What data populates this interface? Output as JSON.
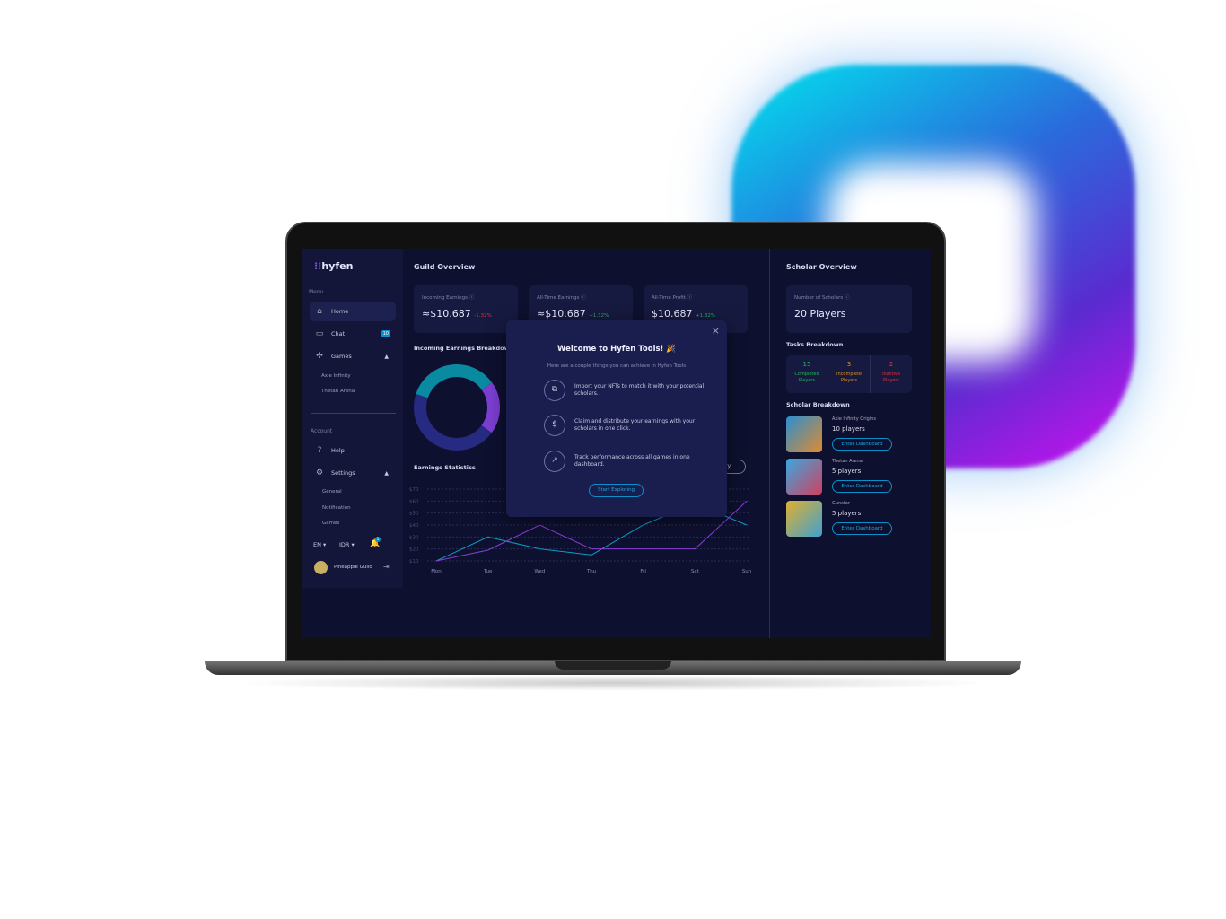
{
  "brand": {
    "name": "hyfen"
  },
  "sidebar": {
    "menu_label": "Menu",
    "items": [
      {
        "label": "Home",
        "icon": "home-icon"
      },
      {
        "label": "Chat",
        "icon": "chat-icon",
        "badge": "10"
      },
      {
        "label": "Games",
        "icon": "gamepad-icon"
      }
    ],
    "games": [
      "Axie Infinity",
      "Thetan Arena"
    ],
    "account_label": "Account",
    "help": "Help",
    "settings": "Settings",
    "settings_sub": [
      "General",
      "Notification",
      "Games"
    ],
    "language": "EN",
    "currency": "IDR",
    "notif_badge": "1",
    "user": "Pineapple Guild"
  },
  "main": {
    "title": "Guild Overview",
    "cards": [
      {
        "label": "Incoming Earnings",
        "value": "≈$10.687",
        "change": "-1.32%",
        "trend": "neg"
      },
      {
        "label": "All-Time Earnings",
        "value": "≈$10.687",
        "change": "+1.32%",
        "trend": "pos"
      },
      {
        "label": "All-Time Profit",
        "value": "$10.687",
        "change": "+1.32%",
        "trend": "pos"
      }
    ],
    "breakdown_title": "Incoming Earnings Breakdown",
    "stats_title": "Earnings Statistics",
    "history_button": "History"
  },
  "chart_data": {
    "type": "line",
    "categories": [
      "Mon",
      "Tue",
      "Wed",
      "Thu",
      "Fri",
      "Sat",
      "Sun"
    ],
    "y_ticks": [
      "$10",
      "$20",
      "$30",
      "$40",
      "$50",
      "$60",
      "$70"
    ],
    "ylim": [
      10,
      70
    ],
    "series": [
      {
        "color": "#0a9fc0",
        "values": [
          10,
          30,
          20,
          15,
          40,
          58,
          40
        ]
      },
      {
        "color": "#8a3fd8",
        "values": [
          10,
          19,
          40,
          20,
          20,
          20,
          60
        ]
      }
    ],
    "grid": true
  },
  "donut": {
    "segments": [
      {
        "color": "#7b3fd0",
        "value": 20
      },
      {
        "color": "#262a80",
        "value": 45
      },
      {
        "color": "#0a8aa0",
        "value": 35
      }
    ]
  },
  "modal": {
    "title": "Welcome to Hyfen Tools!",
    "subtitle": "Here are a couple things you can achieve in Hyfen Tools",
    "features": [
      {
        "icon": "import-icon",
        "text": "Import your NFTs to match it with your potential scholars."
      },
      {
        "icon": "claim-icon",
        "text": "Claim and distribute your earnings with your scholars in one click."
      },
      {
        "icon": "chart-up-icon",
        "text": "Track performance across all games in one dashboard."
      }
    ],
    "cta": "Start Exploring"
  },
  "scholar": {
    "title": "Scholar Overview",
    "count_label": "Number of Scholars",
    "count_value": "20 Players",
    "tasks_title": "Tasks Breakdown",
    "tasks": [
      {
        "n": "15",
        "label": "Completed Players",
        "color": "#1fb95a"
      },
      {
        "n": "3",
        "label": "Incomplete Players",
        "color": "#e08a1a"
      },
      {
        "n": "2",
        "label": "Inactive Players",
        "color": "#e0333a"
      }
    ],
    "breakdown_title": "Scholar Breakdown",
    "games": [
      {
        "name": "Axie Infinity Origins",
        "players": "10 players"
      },
      {
        "name": "Thetan Arena",
        "players": "5 players"
      },
      {
        "name": "Gunstar",
        "players": "5 players"
      }
    ],
    "enter_label": "Enter Dashboard"
  }
}
